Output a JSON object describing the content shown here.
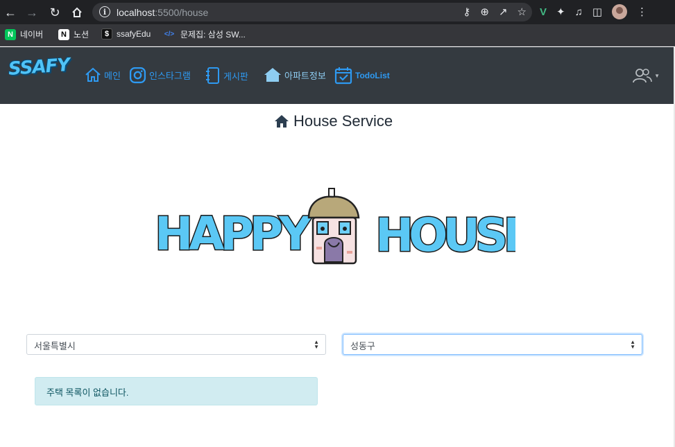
{
  "browser": {
    "url_host": "localhost",
    "url_rest": ":5500/house",
    "bookmarks": [
      {
        "label": "네이버",
        "icon": "naver-icon",
        "icon_glyph": "N",
        "color": "#03c75a"
      },
      {
        "label": "노션",
        "icon": "notion-icon",
        "icon_glyph": "N",
        "color": "#ffffff"
      },
      {
        "label": "ssafyEdu",
        "icon": "ssafy-edu-icon",
        "icon_glyph": "$",
        "color": "#111111"
      },
      {
        "label": "문제집: 삼성 SW...",
        "icon": "code-brackets-icon",
        "icon_glyph": "</>",
        "color": "#4285f4"
      }
    ]
  },
  "navbar": {
    "logo_text": "SSAFY",
    "items": [
      {
        "label": "메인",
        "icon": "home-icon"
      },
      {
        "label": "인스타그램",
        "icon": "instagram-icon"
      },
      {
        "label": "게시판",
        "icon": "notebook-icon"
      },
      {
        "label": "아파트정보",
        "icon": "house-icon"
      },
      {
        "label": "TodoList",
        "icon": "calendar-check-icon"
      }
    ],
    "user_icon": "people-icon"
  },
  "main": {
    "title": "House Service",
    "title_icon": "house-icon",
    "hero_word_left": "HAPPY",
    "hero_word_right": "HOUSE",
    "sido_select": {
      "value": "서울특별시"
    },
    "gugun_select": {
      "value": "성동구"
    },
    "alert_text": "주택 목록이 없습니다."
  },
  "colors": {
    "navbar_bg": "#343a40",
    "link_blue": "#2e9af2",
    "alert_bg": "#d1ecf1",
    "hero_blue": "#5bc8f5"
  }
}
